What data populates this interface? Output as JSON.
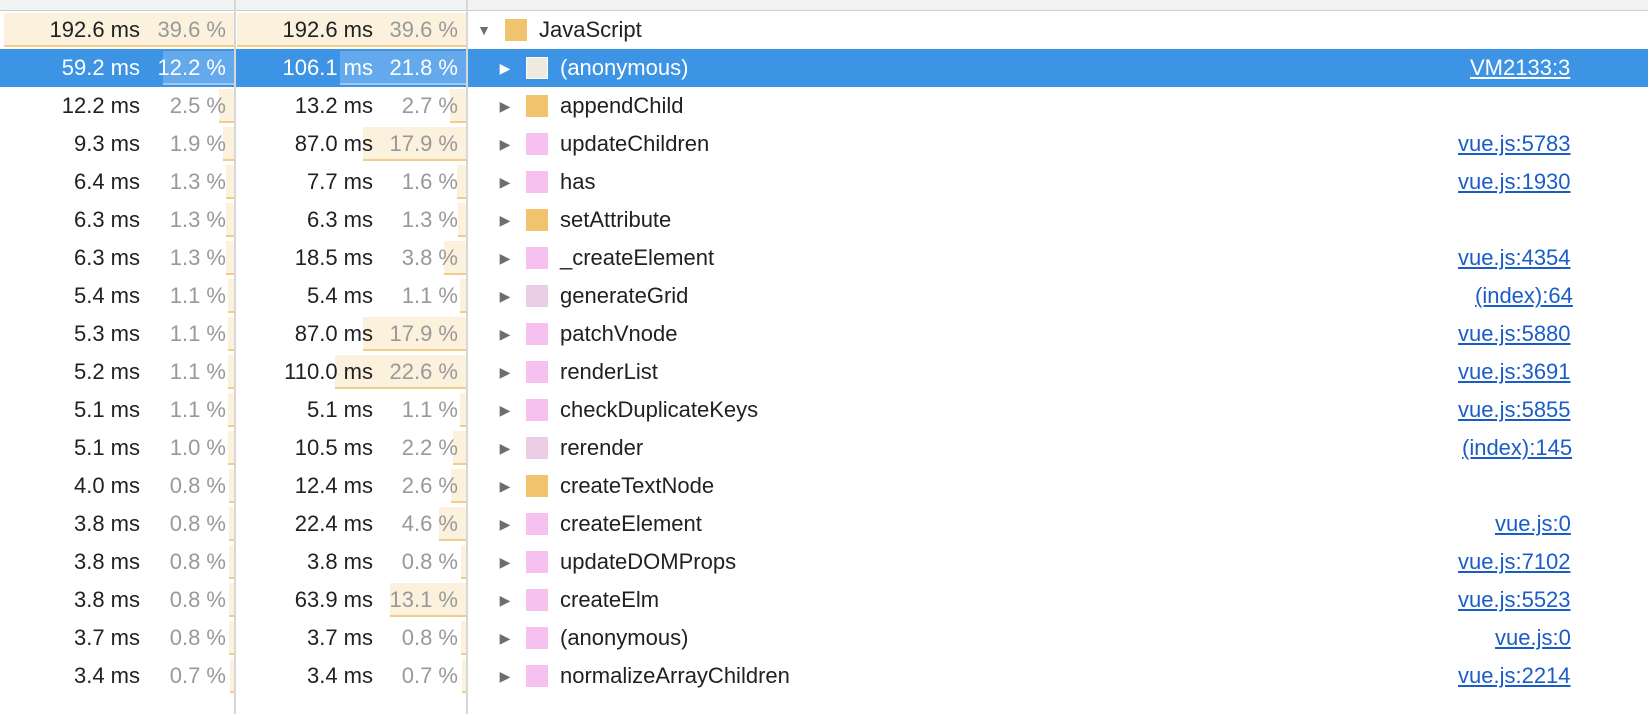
{
  "rows": [
    {
      "self_ms": "192.6 ms",
      "self_pct": "39.6 %",
      "self_frac": 0.396,
      "total_ms": "192.6 ms",
      "total_pct": "39.6 %",
      "total_frac": 0.396,
      "name": "JavaScript",
      "link": "",
      "color": "#f0c36d",
      "expanded": true,
      "selected": false,
      "depth": 0
    },
    {
      "self_ms": "59.2 ms",
      "self_pct": "12.2 %",
      "self_frac": 0.122,
      "total_ms": "106.1 ms",
      "total_pct": "21.8 %",
      "total_frac": 0.218,
      "name": "(anonymous)",
      "link": "VM2133:3",
      "color": "#efeae0",
      "expanded": false,
      "selected": true,
      "depth": 1
    },
    {
      "self_ms": "12.2 ms",
      "self_pct": "2.5 %",
      "self_frac": 0.025,
      "total_ms": "13.2 ms",
      "total_pct": "2.7 %",
      "total_frac": 0.027,
      "name": "appendChild",
      "link": "",
      "color": "#f0c36d",
      "expanded": false,
      "selected": false,
      "depth": 1
    },
    {
      "self_ms": "9.3 ms",
      "self_pct": "1.9 %",
      "self_frac": 0.019,
      "total_ms": "87.0 ms",
      "total_pct": "17.9 %",
      "total_frac": 0.179,
      "name": "updateChildren",
      "link": "vue.js:5783",
      "color": "#f6c1ee",
      "expanded": false,
      "selected": false,
      "depth": 1
    },
    {
      "self_ms": "6.4 ms",
      "self_pct": "1.3 %",
      "self_frac": 0.013,
      "total_ms": "7.7 ms",
      "total_pct": "1.6 %",
      "total_frac": 0.016,
      "name": "has",
      "link": "vue.js:1930",
      "color": "#f6c1ee",
      "expanded": false,
      "selected": false,
      "depth": 1
    },
    {
      "self_ms": "6.3 ms",
      "self_pct": "1.3 %",
      "self_frac": 0.013,
      "total_ms": "6.3 ms",
      "total_pct": "1.3 %",
      "total_frac": 0.013,
      "name": "setAttribute",
      "link": "",
      "color": "#f0c36d",
      "expanded": false,
      "selected": false,
      "depth": 1
    },
    {
      "self_ms": "6.3 ms",
      "self_pct": "1.3 %",
      "self_frac": 0.013,
      "total_ms": "18.5 ms",
      "total_pct": "3.8 %",
      "total_frac": 0.038,
      "name": "_createElement",
      "link": "vue.js:4354",
      "color": "#f6c1ee",
      "expanded": false,
      "selected": false,
      "depth": 1
    },
    {
      "self_ms": "5.4 ms",
      "self_pct": "1.1 %",
      "self_frac": 0.011,
      "total_ms": "5.4 ms",
      "total_pct": "1.1 %",
      "total_frac": 0.011,
      "name": "generateGrid",
      "link": "(index):64",
      "color": "#ebcde6",
      "expanded": false,
      "selected": false,
      "depth": 1
    },
    {
      "self_ms": "5.3 ms",
      "self_pct": "1.1 %",
      "self_frac": 0.011,
      "total_ms": "87.0 ms",
      "total_pct": "17.9 %",
      "total_frac": 0.179,
      "name": "patchVnode",
      "link": "vue.js:5880",
      "color": "#f6c1ee",
      "expanded": false,
      "selected": false,
      "depth": 1
    },
    {
      "self_ms": "5.2 ms",
      "self_pct": "1.1 %",
      "self_frac": 0.011,
      "total_ms": "110.0 ms",
      "total_pct": "22.6 %",
      "total_frac": 0.226,
      "name": "renderList",
      "link": "vue.js:3691",
      "color": "#f6c1ee",
      "expanded": false,
      "selected": false,
      "depth": 1
    },
    {
      "self_ms": "5.1 ms",
      "self_pct": "1.1 %",
      "self_frac": 0.011,
      "total_ms": "5.1 ms",
      "total_pct": "1.1 %",
      "total_frac": 0.011,
      "name": "checkDuplicateKeys",
      "link": "vue.js:5855",
      "color": "#f6c1ee",
      "expanded": false,
      "selected": false,
      "depth": 1
    },
    {
      "self_ms": "5.1 ms",
      "self_pct": "1.0 %",
      "self_frac": 0.01,
      "total_ms": "10.5 ms",
      "total_pct": "2.2 %",
      "total_frac": 0.022,
      "name": "rerender",
      "link": "(index):145",
      "color": "#ebcde6",
      "expanded": false,
      "selected": false,
      "depth": 1
    },
    {
      "self_ms": "4.0 ms",
      "self_pct": "0.8 %",
      "self_frac": 0.008,
      "total_ms": "12.4 ms",
      "total_pct": "2.6 %",
      "total_frac": 0.026,
      "name": "createTextNode",
      "link": "",
      "color": "#f0c36d",
      "expanded": false,
      "selected": false,
      "depth": 1
    },
    {
      "self_ms": "3.8 ms",
      "self_pct": "0.8 %",
      "self_frac": 0.008,
      "total_ms": "22.4 ms",
      "total_pct": "4.6 %",
      "total_frac": 0.046,
      "name": "createElement",
      "link": "vue.js:0",
      "color": "#f6c1ee",
      "expanded": false,
      "selected": false,
      "depth": 1
    },
    {
      "self_ms": "3.8 ms",
      "self_pct": "0.8 %",
      "self_frac": 0.008,
      "total_ms": "3.8 ms",
      "total_pct": "0.8 %",
      "total_frac": 0.008,
      "name": "updateDOMProps",
      "link": "vue.js:7102",
      "color": "#f6c1ee",
      "expanded": false,
      "selected": false,
      "depth": 1
    },
    {
      "self_ms": "3.8 ms",
      "self_pct": "0.8 %",
      "self_frac": 0.008,
      "total_ms": "63.9 ms",
      "total_pct": "13.1 %",
      "total_frac": 0.131,
      "name": "createElm",
      "link": "vue.js:5523",
      "color": "#f6c1ee",
      "expanded": false,
      "selected": false,
      "depth": 1
    },
    {
      "self_ms": "3.7 ms",
      "self_pct": "0.8 %",
      "self_frac": 0.008,
      "total_ms": "3.7 ms",
      "total_pct": "0.8 %",
      "total_frac": 0.008,
      "name": "(anonymous)",
      "link": "vue.js:0",
      "color": "#f6c1ee",
      "expanded": false,
      "selected": false,
      "depth": 1
    },
    {
      "self_ms": "3.4 ms",
      "self_pct": "0.7 %",
      "self_frac": 0.007,
      "total_ms": "3.4 ms",
      "total_pct": "0.7 %",
      "total_frac": 0.007,
      "name": "normalizeArrayChildren",
      "link": "vue.js:2214",
      "color": "#f6c1ee",
      "expanded": false,
      "selected": false,
      "depth": 1
    }
  ],
  "icons": {
    "expanded": "▼",
    "collapsed": "▶"
  }
}
